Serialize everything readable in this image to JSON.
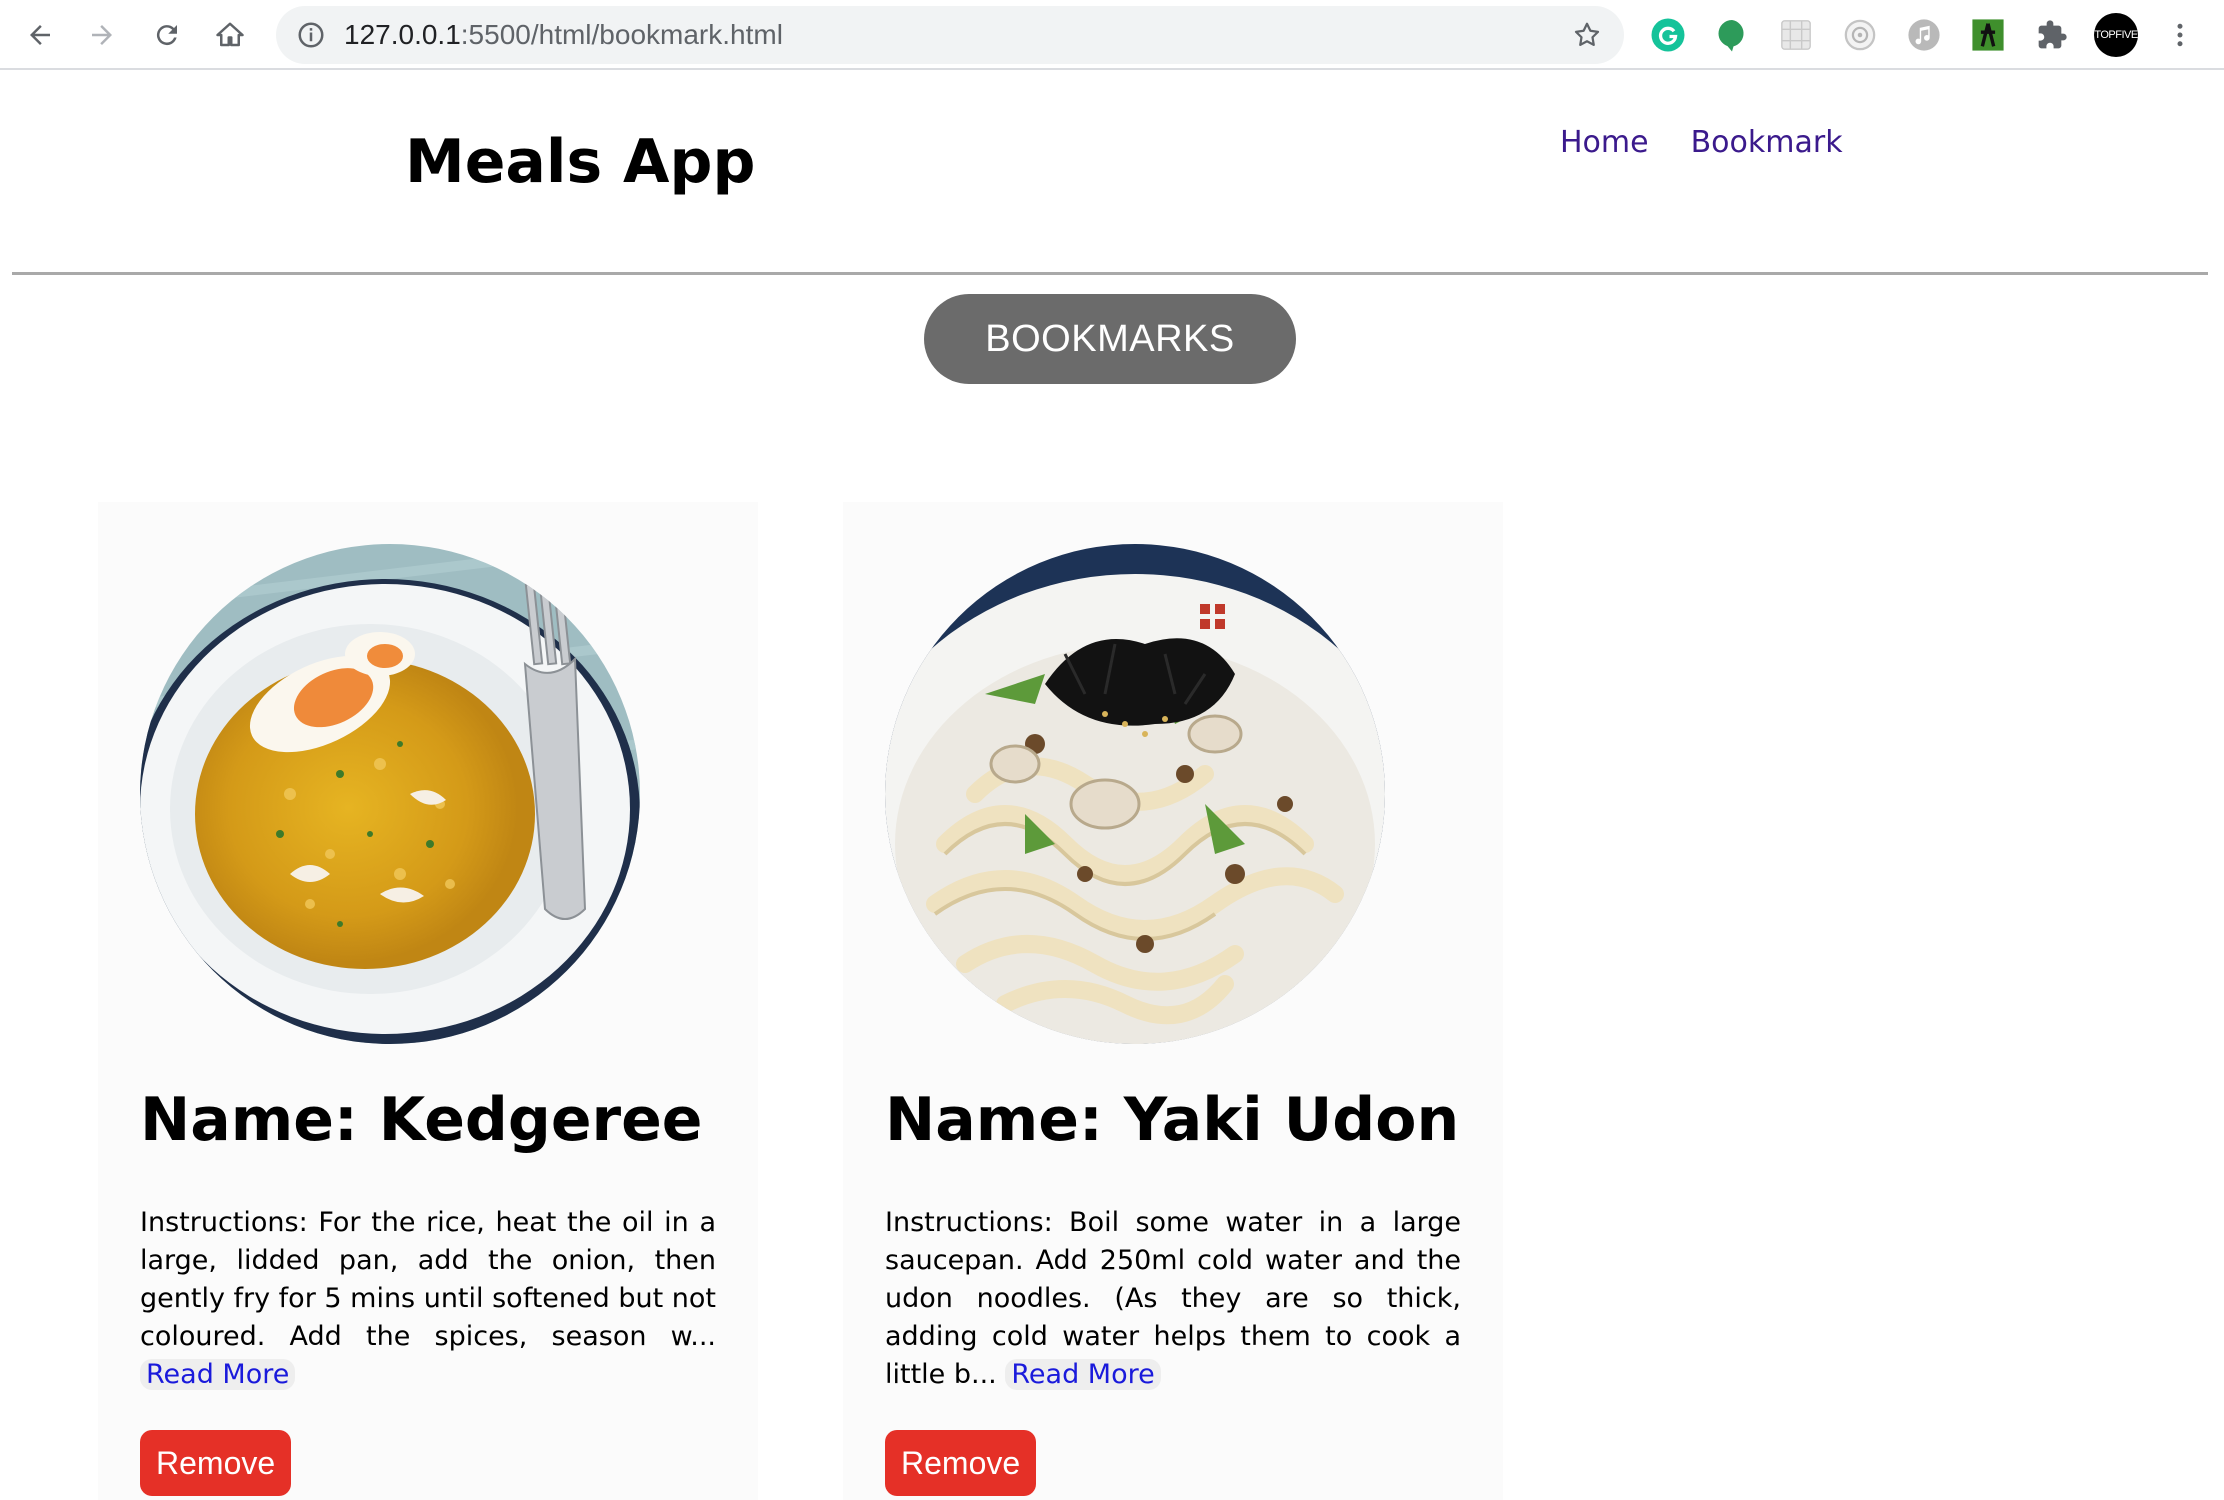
{
  "browser": {
    "url_host": "127.0.0.1",
    "url_path": ":5500/html/bookmark.html",
    "profile_label": "TOPFIVE",
    "icons": [
      "back-icon",
      "forward-icon",
      "reload-icon",
      "home-icon",
      "site-info-icon",
      "bookmark-star-icon",
      "grammarly-extension-icon",
      "green-bubble-extension-icon",
      "grid-extension-icon",
      "target-extension-icon",
      "music-extension-icon",
      "figure-extension-icon",
      "extensions-puzzle-icon",
      "profile-avatar",
      "kebab-menu-icon"
    ]
  },
  "header": {
    "title": "Meals App",
    "nav": [
      {
        "label": "Home"
      },
      {
        "label": "Bookmark"
      }
    ]
  },
  "page_badge": "BOOKMARKS",
  "cards": [
    {
      "name": "Name: Kedgeree",
      "instructions": "Instructions: For the rice, heat the oil in a large, lidded pan, add the onion, then gently fry for 5 mins until softened but not coloured. Add the spices, season w...",
      "read_more": "Read More",
      "remove": "Remove"
    },
    {
      "name": "Name: Yaki Udon",
      "instructions": "Instructions: Boil some water in a large saucepan. Add 250ml cold water and the udon noodles. (As they are so thick, adding cold water helps them to cook a little b...",
      "read_more": "Read More",
      "remove": "Remove"
    }
  ],
  "colors": {
    "nav_link": "#3b1a8c",
    "badge_bg": "#6b6b6b",
    "remove_bg": "#e53027",
    "read_more": "#1a1adb"
  }
}
